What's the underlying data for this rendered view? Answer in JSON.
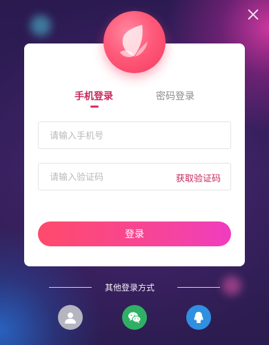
{
  "tabs": [
    {
      "label": "手机登录",
      "active": true
    },
    {
      "label": "密码登录",
      "active": false
    }
  ],
  "phone": {
    "placeholder": "请输入手机号",
    "value": ""
  },
  "code": {
    "placeholder": "请输入验证码",
    "value": "",
    "get_code_label": "获取验证码"
  },
  "login_label": "登录",
  "other_methods_label": "其他登录方式",
  "icons": {
    "close": "close-icon",
    "logo": "butterfly-logo",
    "social": [
      "user-icon",
      "wechat-icon",
      "qq-icon"
    ]
  },
  "colors": {
    "accent": "#c8285a",
    "button_start": "#ff4a6a",
    "button_end": "#f03cc0",
    "wechat": "#2fb064",
    "qq": "#2f8fe0"
  }
}
